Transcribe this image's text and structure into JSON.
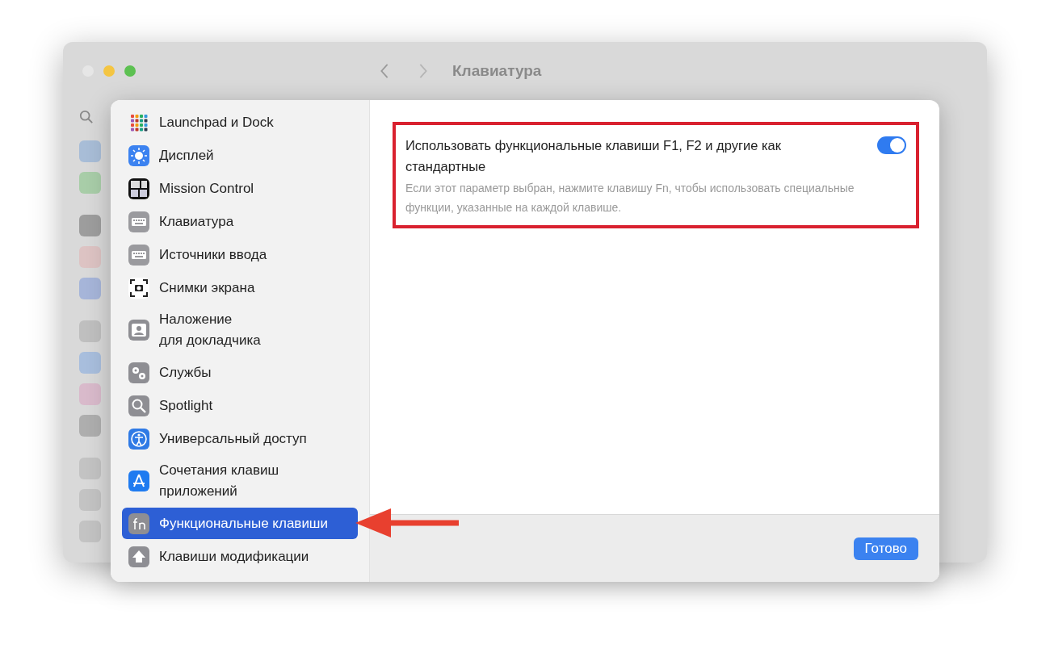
{
  "window": {
    "title": "Клавиатура"
  },
  "sheet": {
    "sidebar": {
      "items": [
        {
          "label": "Launchpad и Dock",
          "selected": false
        },
        {
          "label": "Дисплей",
          "selected": false
        },
        {
          "label": "Mission Control",
          "selected": false
        },
        {
          "label": "Клавиатура",
          "selected": false
        },
        {
          "label": "Источники ввода",
          "selected": false
        },
        {
          "label": "Снимки экрана",
          "selected": false
        },
        {
          "label": "Наложение\nдля докладчика",
          "selected": false
        },
        {
          "label": "Службы",
          "selected": false
        },
        {
          "label": "Spotlight",
          "selected": false
        },
        {
          "label": "Универсальный доступ",
          "selected": false
        },
        {
          "label": "Сочетания клавиш\nприложений",
          "selected": false
        },
        {
          "label": "Функциональные клавиши",
          "selected": true
        },
        {
          "label": "Клавиши модификации",
          "selected": false
        }
      ]
    },
    "setting": {
      "title": "Использовать функциональные клавиши F1, F2 и другие как стандартные",
      "description": "Если этот параметр выбран, нажмите клавишу Fn, чтобы использовать специальные функции, указанные на каждой клавише.",
      "on": true
    },
    "done_button": "Готово"
  }
}
